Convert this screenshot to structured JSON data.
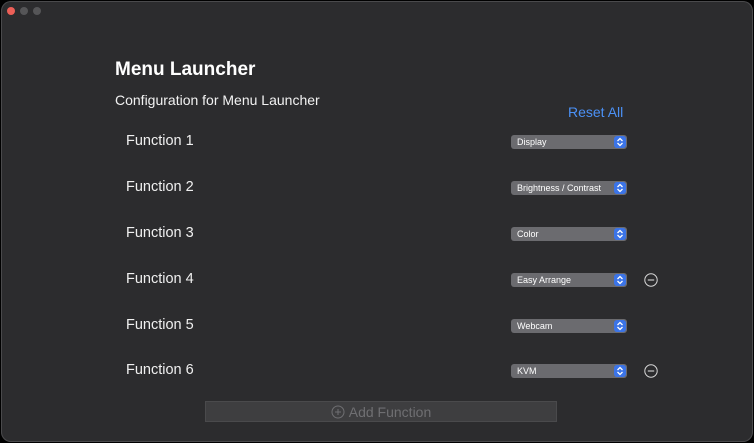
{
  "page": {
    "title": "Menu Launcher",
    "subtitle": "Configuration for Menu Launcher",
    "reset_label": "Reset All",
    "add_label": "Add Function"
  },
  "functions": [
    {
      "label": "Function 1",
      "value": "Display",
      "removable": false
    },
    {
      "label": "Function 2",
      "value": "Brightness / Contrast",
      "removable": false
    },
    {
      "label": "Function 3",
      "value": "Color",
      "removable": false
    },
    {
      "label": "Function 4",
      "value": "Easy Arrange",
      "removable": true
    },
    {
      "label": "Function 5",
      "value": "Webcam",
      "removable": false
    },
    {
      "label": "Function 6",
      "value": "KVM",
      "removable": true
    }
  ],
  "colors": {
    "accent": "#3b74e8",
    "link": "#4b91f6",
    "background": "#2c2c2e"
  }
}
